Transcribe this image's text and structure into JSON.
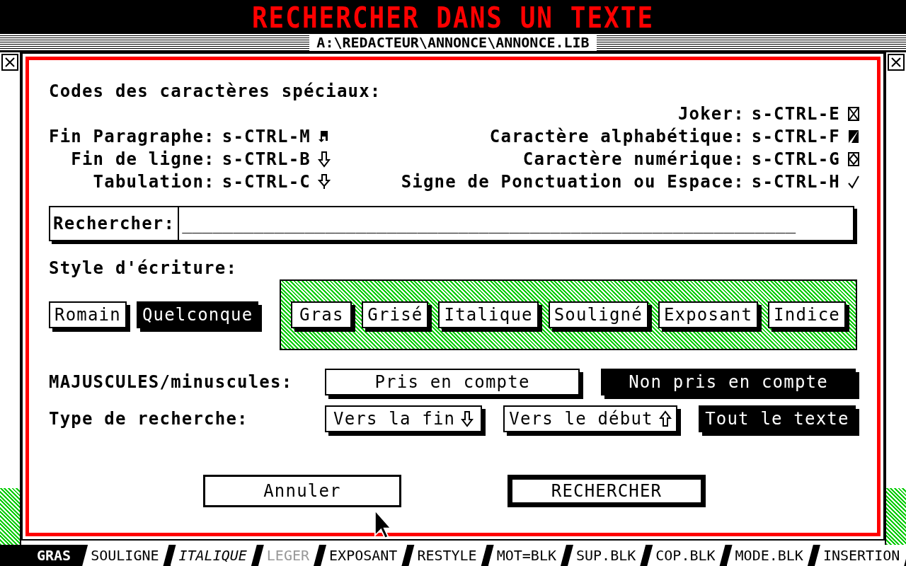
{
  "screen_title": "RECHERCHER DANS UN TEXTE",
  "window": {
    "title": "A:\\REDACTEUR\\ANNONCE\\ANNONCE.LIB"
  },
  "dialog": {
    "special_codes": {
      "title": "Codes des caractères spéciaux:",
      "left": [
        {
          "label": "Fin Paragraphe:",
          "code": "s-CTRL-M",
          "kind": "paragraph"
        },
        {
          "label": "Fin de ligne:",
          "code": "s-CTRL-B",
          "kind": "down"
        },
        {
          "label": "Tabulation:",
          "code": "s-CTRL-C",
          "kind": "tab"
        }
      ],
      "right": [
        {
          "label": "Joker:",
          "code": "s-CTRL-E",
          "kind": "cross"
        },
        {
          "label": "Caractère alphabétique:",
          "code": "s-CTRL-F",
          "kind": "triangle"
        },
        {
          "label": "Caractère numérique:",
          "code": "s-CTRL-G",
          "kind": "diamond"
        },
        {
          "label": "Signe de Ponctuation ou Espace:",
          "code": "s-CTRL-H",
          "kind": "check"
        }
      ]
    },
    "search": {
      "label": "Rechercher:",
      "placeholder": "____________________________________________________________"
    },
    "style": {
      "label": "Style d'écriture:",
      "modes": [
        {
          "label": "Romain",
          "selected": false
        },
        {
          "label": "Quelconque",
          "selected": true
        }
      ],
      "attributes": [
        {
          "label": "Gras",
          "selected": false
        },
        {
          "label": "Grisé",
          "selected": false
        },
        {
          "label": "Italique",
          "selected": false
        },
        {
          "label": "Souligné",
          "selected": false
        },
        {
          "label": "Exposant",
          "selected": false
        },
        {
          "label": "Indice",
          "selected": false
        }
      ]
    },
    "case": {
      "label": "MAJUSCULES/minuscules:",
      "options": [
        {
          "label": "Pris en compte",
          "selected": false
        },
        {
          "label": "Non pris en compte",
          "selected": true
        }
      ]
    },
    "direction": {
      "label": "Type de recherche:",
      "options": [
        {
          "label": "Vers la fin",
          "kind": "down",
          "selected": false
        },
        {
          "label": "Vers le début",
          "kind": "up",
          "selected": false
        },
        {
          "label": "Tout le texte",
          "kind": "plain",
          "selected": true
        }
      ]
    },
    "buttons": [
      {
        "label": "Annuler",
        "default": false
      },
      {
        "label": "RECHERCHER",
        "default": true
      }
    ]
  },
  "status_bar": [
    {
      "label": "GRAS",
      "kind": "bold",
      "selected": true
    },
    {
      "label": "SOULIGNE",
      "kind": "plain",
      "selected": false
    },
    {
      "label": "ITALIQUE",
      "kind": "italic",
      "selected": false
    },
    {
      "label": "LEGER",
      "kind": "light",
      "selected": false
    },
    {
      "label": "EXPOSANT",
      "kind": "plain",
      "selected": false
    },
    {
      "label": "RESTYLE",
      "kind": "plain",
      "selected": false
    },
    {
      "label": "MOT=BLK",
      "kind": "plain",
      "selected": false
    },
    {
      "label": "SUP.BLK",
      "kind": "plain",
      "selected": false
    },
    {
      "label": "COP.BLK",
      "kind": "plain",
      "selected": false
    },
    {
      "label": "MODE.BLK",
      "kind": "plain",
      "selected": false
    },
    {
      "label": "INSERTION",
      "kind": "plain",
      "selected": false
    }
  ]
}
